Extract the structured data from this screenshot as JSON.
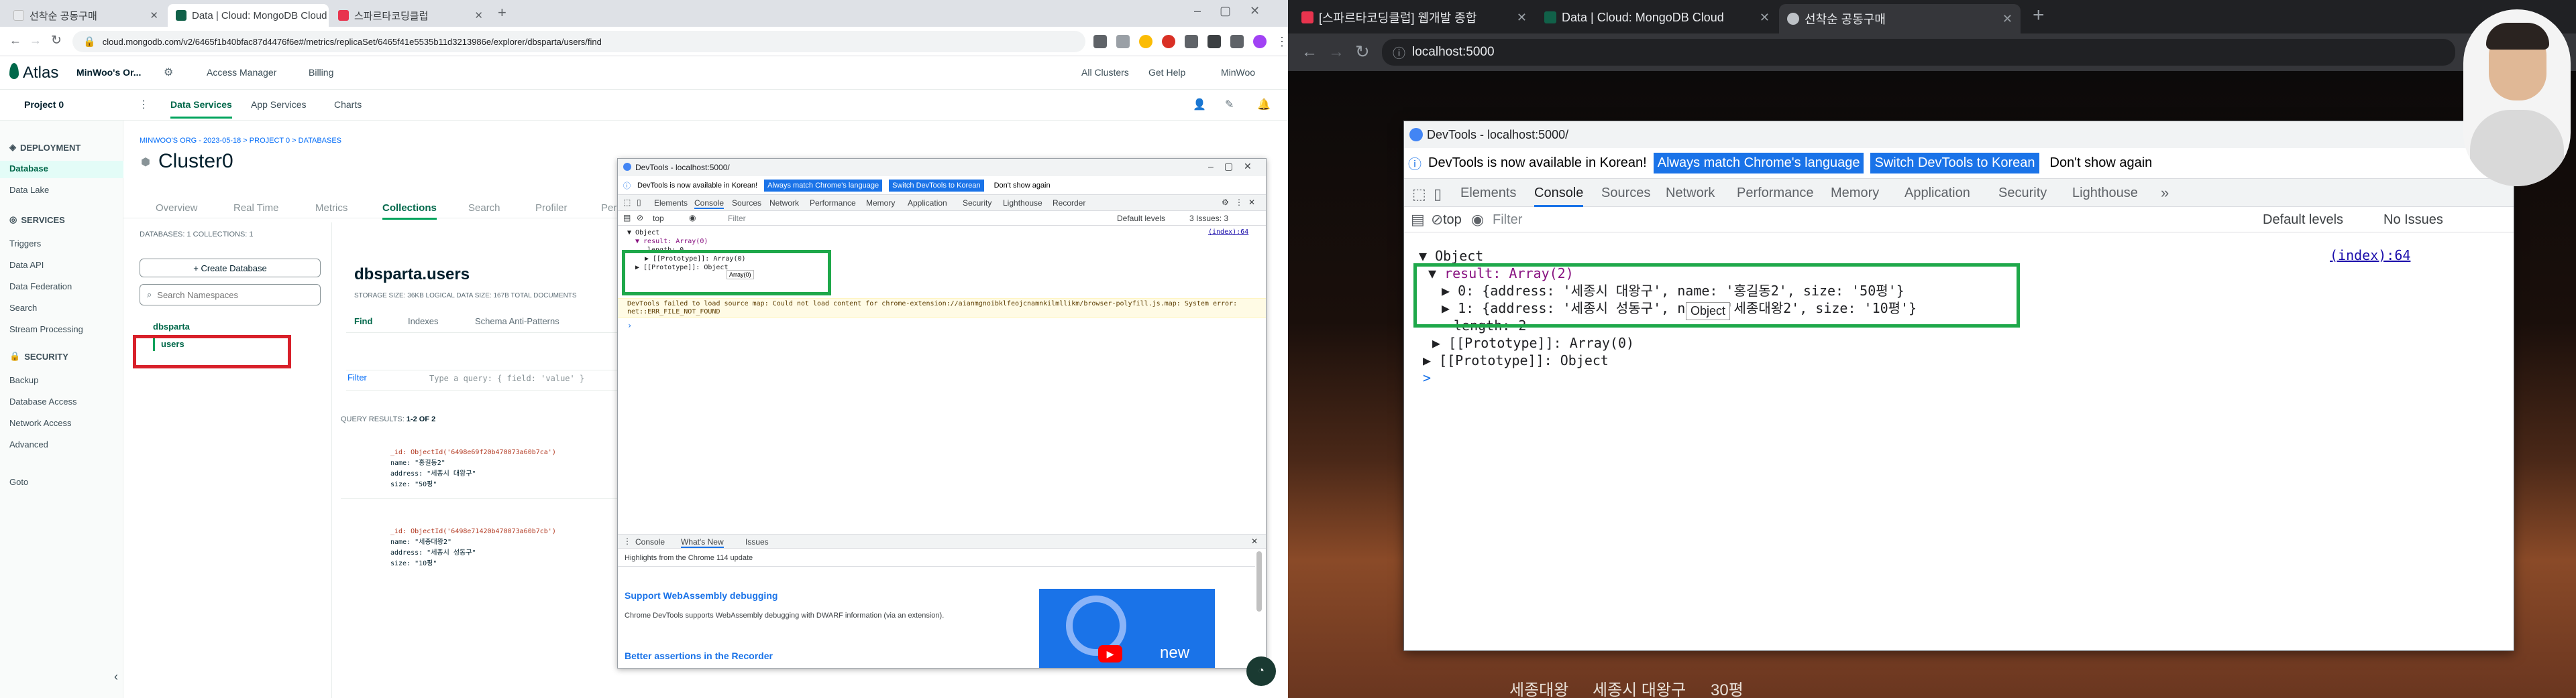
{
  "left_browser": {
    "tabs": [
      {
        "label": "선착순 공동구매",
        "icon_color": "#e8eaed"
      },
      {
        "label": "Data | Cloud: MongoDB Cloud",
        "icon_color": "#116149"
      },
      {
        "label": "스파르타코딩클럽",
        "icon_color": "#e8344e"
      }
    ],
    "new_tab": "+",
    "url": "cloud.mongodb.com/v2/6465f1b40bfac87d4476f6e#/metrics/replicaSet/6465f41e5535b11d3213986e/explorer/dbsparta/users/find"
  },
  "atlas": {
    "logo": "Atlas",
    "org": "MinWoo's Or...",
    "access_manager": "Access Manager",
    "billing": "Billing",
    "all_clusters": "All Clusters",
    "get_help": "Get Help",
    "user": "MinWoo",
    "project": "Project 0",
    "nav_tabs": [
      "Data Services",
      "App Services",
      "Charts"
    ],
    "sidebar": {
      "deployment_header": "DEPLOYMENT",
      "deployment_items": [
        "Database",
        "Data Lake"
      ],
      "services_header": "SERVICES",
      "services_items": [
        "Triggers",
        "Data API",
        "Data Federation",
        "Search",
        "Stream Processing"
      ],
      "security_header": "SECURITY",
      "security_items": [
        "Backup",
        "Database Access",
        "Network Access",
        "Advanced"
      ],
      "goto": "Goto"
    },
    "breadcrumb": "MINWOO'S ORG - 2023-05-18 > PROJECT 0 > DATABASES",
    "cluster_name": "Cluster0",
    "cluster_tabs": [
      "Overview",
      "Real Time",
      "Metrics",
      "Collections",
      "Search",
      "Profiler",
      "Per"
    ],
    "db_counts": "DATABASES: 1   COLLECTIONS: 1",
    "create_db": "+ Create Database",
    "search_ns_placeholder": "Search Namespaces",
    "db_name": "dbsparta",
    "collection_name": "users",
    "collection_title": "dbsparta.users",
    "storage": "STORAGE SIZE: 36KB    LOGICAL DATA SIZE: 167B    TOTAL DOCUMENTS",
    "coll_tabs": [
      "Find",
      "Indexes",
      "Schema Anti-Patterns"
    ],
    "filter_label": "Filter",
    "filter_placeholder": "Type a query: { field: 'value' }",
    "results_label": "QUERY RESULTS:",
    "results_count": "1-2 OF 2",
    "docs": [
      {
        "id": "_id: ObjectId('6498e69f20b470073a60b7ca')",
        "name": "name: \"홍길동2\"",
        "address": "address: \"세종시 대왕구\"",
        "size": "size: \"50평\""
      },
      {
        "id": "_id: ObjectId('6498e71420b470073a60b7cb')",
        "name": "name: \"세종대왕2\"",
        "address": "address: \"세종시 성동구\"",
        "size": "size: \"10평\""
      }
    ]
  },
  "small_devtools": {
    "title": "DevTools - localhost:5000/",
    "banner": "DevTools is now available in Korean!",
    "btn1": "Always match Chrome's language",
    "btn2": "Switch DevTools to Korean",
    "btn3": "Don't show again",
    "tabs": [
      "Elements",
      "Console",
      "Sources",
      "Network",
      "Performance",
      "Memory",
      "Application",
      "Security",
      "Lighthouse",
      "Recorder"
    ],
    "issues": "3 Issues: 3",
    "context": "top",
    "filter": "Filter",
    "levels": "Default levels",
    "index": "(index):64",
    "lines": [
      "▼ Object",
      "▼ result: Array(0)",
      "length: 0",
      "▶ [[Prototype]]: Array(0)",
      "▶ [[Prototype]]: Object"
    ],
    "tooltip": "Array(0)",
    "warning": "DevTools failed to load source map: Could not load content for chrome-extension://aianmgnoibklfeojcnamnkilmllikm/browser-polyfill.js.map: System error: net::ERR_FILE_NOT_FOUND",
    "drawer_tabs": [
      "Console",
      "What's New",
      "Issues"
    ],
    "highlights": "Highlights from the Chrome 114 update",
    "h1": "Support WebAssembly debugging",
    "p1": "Chrome DevTools supports WebAssembly debugging with DWARF information (via an extension).",
    "h2": "Better assertions in the Recorder",
    "new_label": "new"
  },
  "right_browser": {
    "tabs": [
      {
        "label": "[스파르타코딩클럽] 웹개발 종합",
        "icon_color": "#e8344e"
      },
      {
        "label": "Data | Cloud: MongoDB Cloud",
        "icon_color": "#116149"
      },
      {
        "label": "선착순 공동구매",
        "icon_color": "#bdc1c6"
      }
    ],
    "new_tab": "+",
    "url": "localhost:5000"
  },
  "big_devtools": {
    "title": "DevTools - localhost:5000/",
    "banner": "DevTools is now available in Korean!",
    "btn1": "Always match Chrome's language",
    "btn2": "Switch DevTools to Korean",
    "btn3": "Don't show again",
    "tabs": [
      "Elements",
      "Console",
      "Sources",
      "Network",
      "Performance",
      "Memory",
      "Application",
      "Security",
      "Lighthouse"
    ],
    "context": "top",
    "filter": "Filter",
    "levels": "Default levels",
    "no_issues": "No Issues",
    "index": "(index):64",
    "obj": "Object",
    "result": "result: Array(2)",
    "item0": "0: {address: '세종시 대왕구', name: '홍길동2', size: '50평'}",
    "item1": "1: {address: '세종시 성동구', name: '세종대왕2', size: '10평'}",
    "length": "length: 2",
    "proto_arr": "[[Prototype]]: Array(0)",
    "proto_obj": "[[Prototype]]: Object",
    "tooltip": "Object",
    "prompt": ">"
  },
  "page_bottom": [
    "세종대왕",
    "세종시 대왕구",
    "30평"
  ]
}
